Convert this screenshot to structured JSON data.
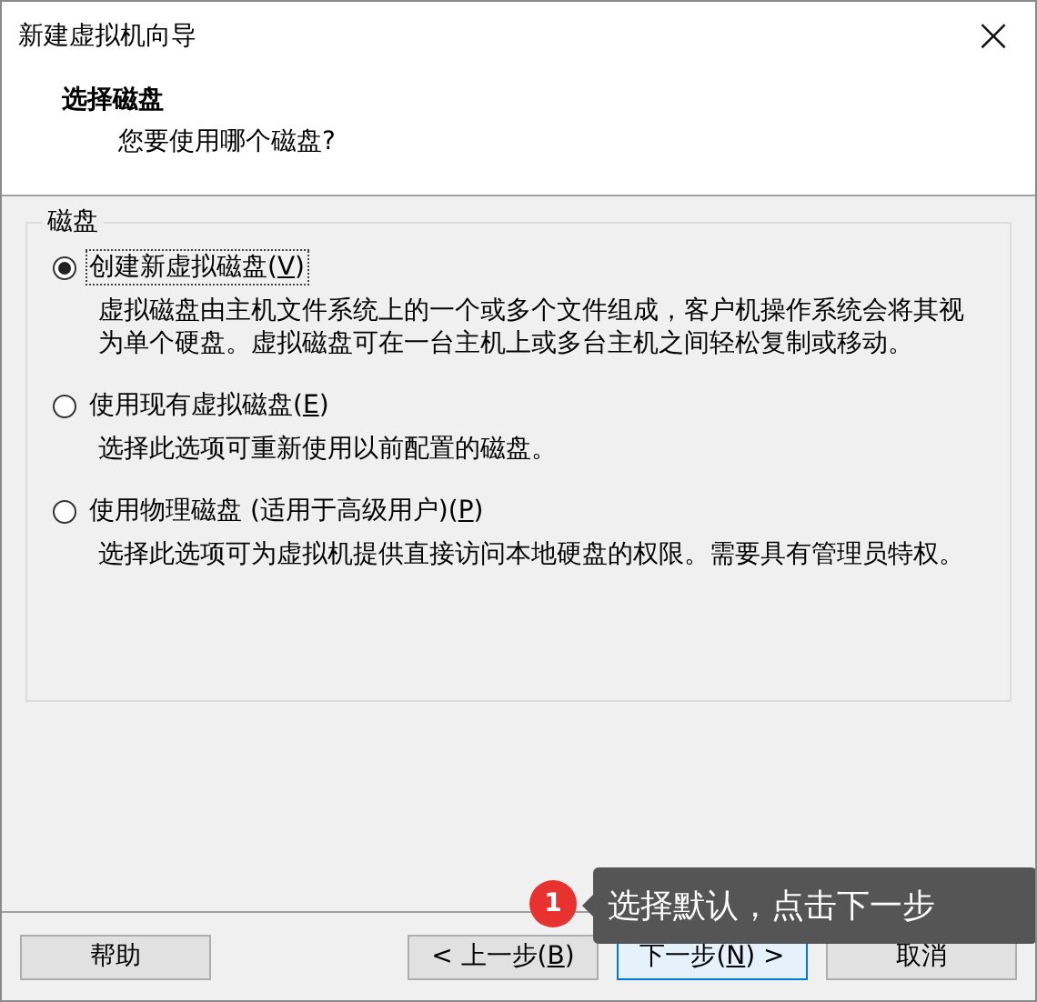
{
  "window": {
    "title": "新建虚拟机向导",
    "close": "×"
  },
  "header": {
    "title": "选择磁盘",
    "subtitle": "您要使用哪个磁盘?"
  },
  "group": {
    "title": "磁盘",
    "options": [
      {
        "before": "创建新虚拟磁盘(",
        "key": "V",
        "after": ")",
        "selected": true,
        "focused": true,
        "description": "虚拟磁盘由主机文件系统上的一个或多个文件组成，客户机操作系统会将其视为单个硬盘。虚拟磁盘可在一台主机上或多台主机之间轻松复制或移动。"
      },
      {
        "before": "使用现有虚拟磁盘(",
        "key": "E",
        "after": ")",
        "selected": false,
        "focused": false,
        "description": "选择此选项可重新使用以前配置的磁盘。"
      },
      {
        "before": "使用物理磁盘 (适用于高级用户)(",
        "key": "P",
        "after": ")",
        "selected": false,
        "focused": false,
        "description": "选择此选项可为虚拟机提供直接访问本地硬盘的权限。需要具有管理员特权。"
      }
    ]
  },
  "buttons": [
    {
      "before": "帮助",
      "default": false
    },
    {
      "before": "< 上一步(",
      "key": "B",
      "after": ")",
      "default": false
    },
    {
      "before": "下一步(",
      "key": "N",
      "after": ") >",
      "default": true
    },
    {
      "before": "取消",
      "default": false
    }
  ],
  "callout": {
    "badge": "1",
    "text": "选择默认，点击下一步"
  }
}
